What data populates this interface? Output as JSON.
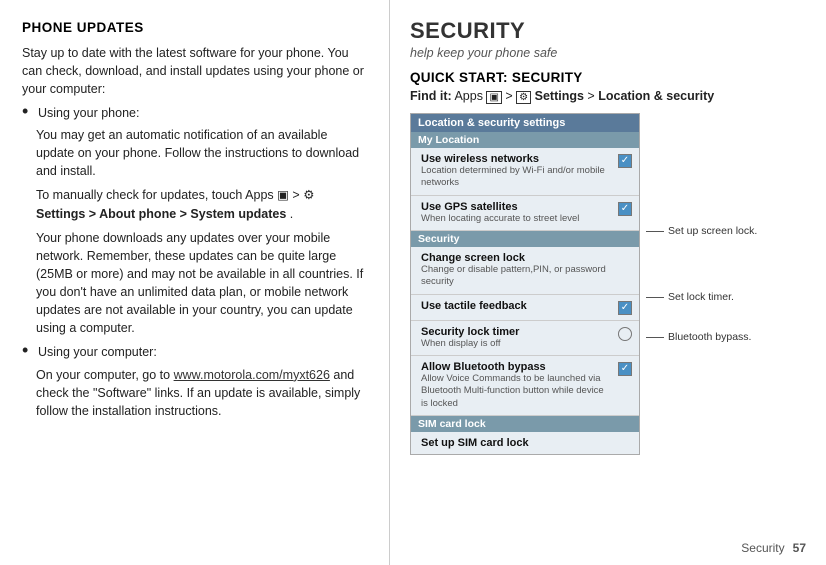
{
  "left": {
    "heading": "PHONE UPDATES",
    "intro": "Stay up to date with the latest software for your phone. You can check, download, and install updates using your phone or your computer:",
    "bullet1_label": "Using your phone:",
    "bullet1_sub1": "You may get an automatic notification of an available update on your phone. Follow the instructions to download and install.",
    "bullet1_sub2_prefix": "To manually check for updates, touch Apps",
    "bullet1_sub2_mid": " > ",
    "bullet1_sub2_bold": "Settings > About phone > System updates",
    "bullet1_sub2_end": ".",
    "bullet1_sub3": "Your phone downloads any updates over your mobile network. Remember, these updates can be quite large (25MB or more) and may not be available in all countries. If you don't have an unlimited data plan, or mobile network updates are not available in your country, you can update using a computer.",
    "bullet2_label": "Using your computer:",
    "bullet2_sub1_prefix": "On your computer, go to",
    "bullet2_sub1_url": "www.motorola.com/myxt626",
    "bullet2_sub1_end": " and check the \"Software\" links. If an update is available, simply follow the installation instructions."
  },
  "right": {
    "section_title": "SECURITY",
    "section_subtitle": "help keep your phone safe",
    "quick_start_label": "QUICK START: SECURITY",
    "find_it_label": "Find it:",
    "find_it_text": "Apps",
    "find_it_arrow": ">",
    "find_it_settings": "Settings",
    "find_it_arrow2": ">",
    "find_it_location": "Location & security",
    "settings_panel": {
      "header": "Location & security settings",
      "section1": "My Location",
      "item1_title": "Use wireless networks",
      "item1_desc": "Location determined by Wi-Fi and/or mobile networks",
      "item1_checked": true,
      "item2_title": "Use GPS satellites",
      "item2_desc": "When locating accurate to street level",
      "item2_checked": true,
      "section2": "Security",
      "item3_title": "Change screen lock",
      "item3_desc": "Change or disable pattern,PIN, or password security",
      "item3_checked": false,
      "item4_title": "Use tactile feedback",
      "item4_checked": true,
      "item5_title": "Security lock timer",
      "item5_desc": "When display is off",
      "item5_radio": true,
      "item6_title": "Allow Bluetooth bypass",
      "item6_desc": "Allow Voice Commands to be launched via Bluetooth Multi-function button while device is locked",
      "item6_checked": true,
      "section3": "SIM card lock",
      "item7_title": "Set up SIM card lock"
    },
    "callout1": "Set up screen lock.",
    "callout2": "Set lock timer.",
    "callout3": "Bluetooth bypass.",
    "page_label": "Security",
    "page_number": "57"
  }
}
